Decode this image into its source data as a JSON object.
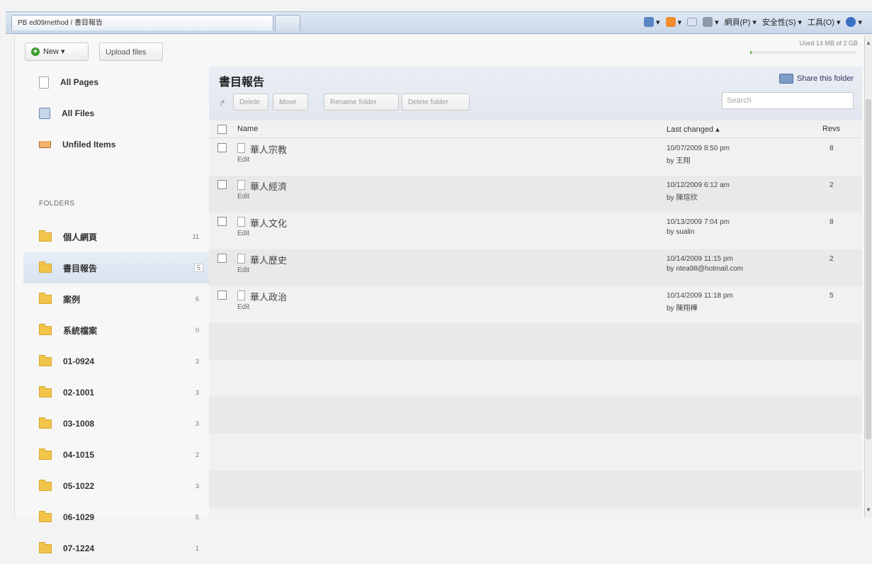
{
  "browser": {
    "tab_title": "PB ed09method / 書目報告",
    "commands": [
      "網頁(P)",
      "安全性(S)",
      "工具(O)"
    ],
    "icon_names": [
      "home-icon",
      "rss-icon",
      "mail-icon",
      "print-icon",
      "help-icon"
    ]
  },
  "toolbar": {
    "new_label": "New ▾",
    "upload_label": "Upload files",
    "storage_text": "Used 14 MB of 2 GB",
    "storage_fraction": 0.007
  },
  "sidebar": {
    "top_items": [
      {
        "label": "All Pages",
        "icon": "pages-icon"
      },
      {
        "label": "All Files",
        "icon": "files-icon"
      },
      {
        "label": "Unfiled Items",
        "icon": "tray-icon"
      }
    ],
    "folders_heading": "FOLDERS",
    "folders": [
      {
        "label": "個人網頁",
        "count": "11"
      },
      {
        "label": "書目報告",
        "count": "5",
        "selected": true
      },
      {
        "label": "案例",
        "count": "6"
      },
      {
        "label": "系統檔案",
        "count": "0"
      },
      {
        "label": "01-0924",
        "count": "3"
      },
      {
        "label": "02-1001",
        "count": "3"
      },
      {
        "label": "03-1008",
        "count": "3"
      },
      {
        "label": "04-1015",
        "count": "2"
      },
      {
        "label": "05-1022",
        "count": "3"
      },
      {
        "label": "06-1029",
        "count": "5"
      },
      {
        "label": "07-1224",
        "count": "1"
      }
    ]
  },
  "main": {
    "folder_title": "書目報告",
    "share_label": "Share this folder",
    "actions": [
      "Delete",
      "Move",
      "Rename folder",
      "Delete folder"
    ],
    "search_placeholder": "Search",
    "columns": {
      "name": "Name",
      "last_changed": "Last changed ▴",
      "revs": "Revs"
    },
    "rows": [
      {
        "name": "華人宗教",
        "edit": "Edit",
        "date": "10/07/2009 8:50 pm",
        "by": "by 王翔",
        "revs": "8"
      },
      {
        "name": "華人經濟",
        "edit": "Edit",
        "date": "10/12/2009 6:12 am",
        "by": "by 陳瑄欣",
        "revs": "2"
      },
      {
        "name": "華人文化",
        "edit": "Edit",
        "date": "10/13/2009 7:04 pm",
        "by": "by sualin",
        "revs": "8"
      },
      {
        "name": "華人歷史",
        "edit": "Edit",
        "date": "10/14/2009 11:15 pm",
        "by": "by ntea98@hotmail.com",
        "revs": "2"
      },
      {
        "name": "華人政治",
        "edit": "Edit",
        "date": "10/14/2009 11:18 pm",
        "by": "by 陳翔樺",
        "revs": "5"
      }
    ]
  }
}
